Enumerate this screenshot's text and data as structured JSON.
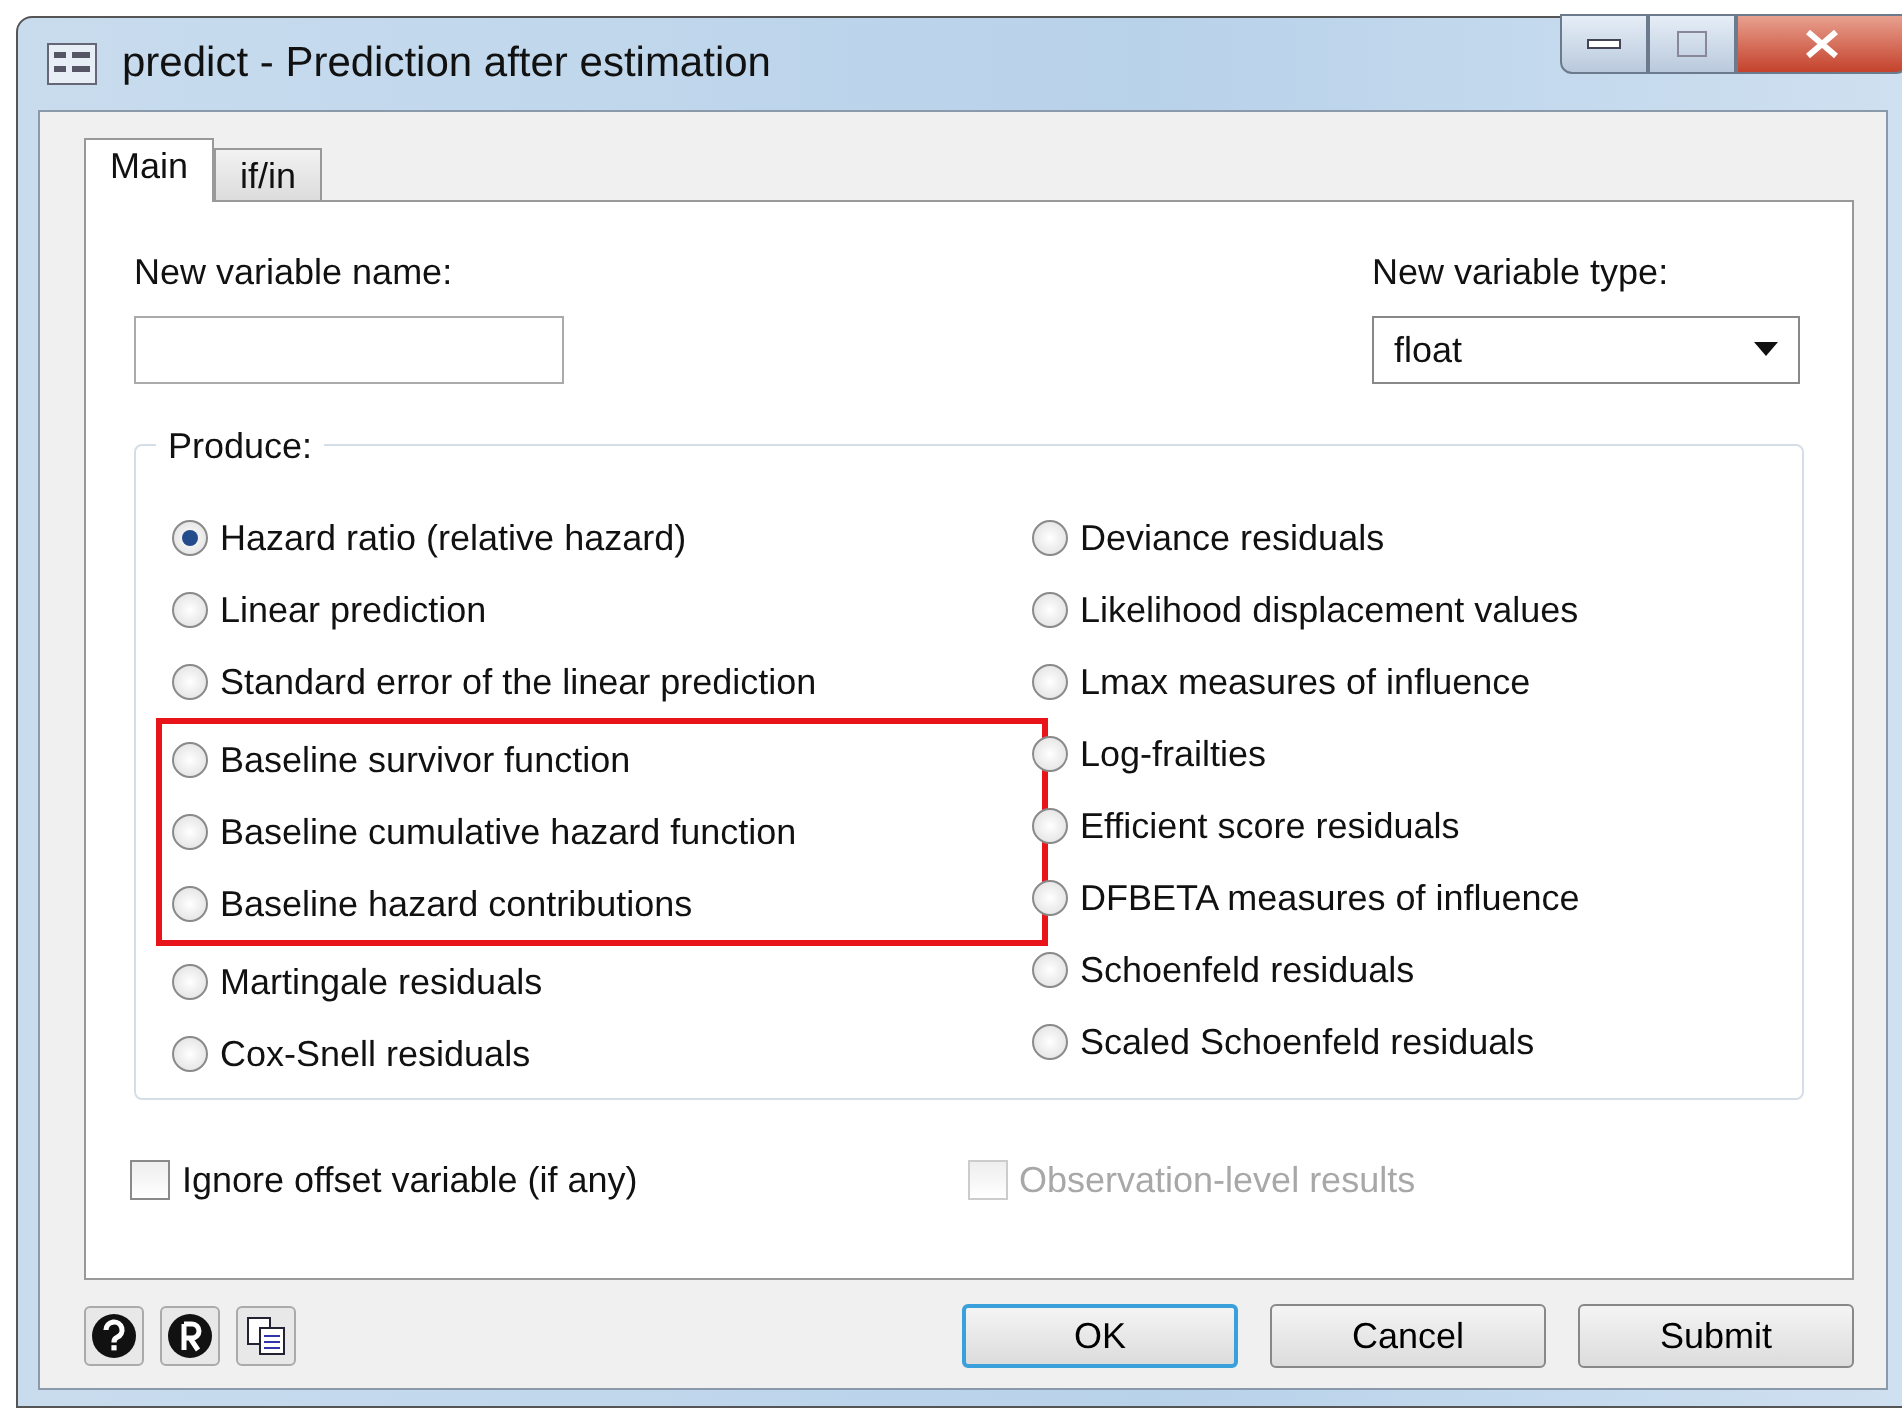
{
  "window": {
    "title": "predict - Prediction after estimation"
  },
  "tabs": [
    {
      "label": "Main",
      "selected": true
    },
    {
      "label": "if/in",
      "selected": false
    }
  ],
  "new_variable_name": {
    "label": "New variable name:"
  },
  "new_variable_type": {
    "label": "New variable type:",
    "value": "float"
  },
  "produce": {
    "label": "Produce:",
    "left": [
      {
        "label": "Hazard ratio (relative hazard)",
        "selected": true,
        "highlighted": false
      },
      {
        "label": "Linear prediction",
        "selected": false,
        "highlighted": false
      },
      {
        "label": "Standard error of the linear prediction",
        "selected": false,
        "highlighted": false
      },
      {
        "label": "Baseline survivor function",
        "selected": false,
        "highlighted": true
      },
      {
        "label": "Baseline cumulative hazard function",
        "selected": false,
        "highlighted": true
      },
      {
        "label": "Baseline hazard contributions",
        "selected": false,
        "highlighted": true
      },
      {
        "label": "Martingale residuals",
        "selected": false,
        "highlighted": false
      },
      {
        "label": "Cox-Snell residuals",
        "selected": false,
        "highlighted": false
      }
    ],
    "right": [
      {
        "label": "Deviance residuals",
        "selected": false
      },
      {
        "label": "Likelihood displacement values",
        "selected": false
      },
      {
        "label": "Lmax measures of influence",
        "selected": false
      },
      {
        "label": "Log-frailties",
        "selected": false
      },
      {
        "label": "Efficient score residuals",
        "selected": false
      },
      {
        "label": "DFBETA measures of influence",
        "selected": false
      },
      {
        "label": "Schoenfeld residuals",
        "selected": false
      },
      {
        "label": "Scaled Schoenfeld residuals",
        "selected": false
      }
    ]
  },
  "options": [
    {
      "label": "Ignore offset variable (if any)",
      "checked": false,
      "disabled": false
    },
    {
      "label": "Observation-level results",
      "checked": false,
      "disabled": true
    }
  ],
  "buttons": [
    {
      "label": "OK",
      "default": true
    },
    {
      "label": "Cancel",
      "default": false
    },
    {
      "label": "Submit",
      "default": false
    }
  ]
}
